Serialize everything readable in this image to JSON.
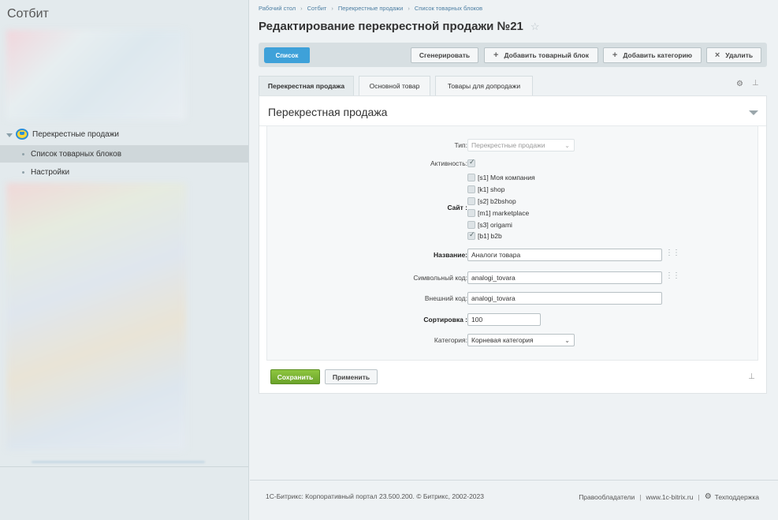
{
  "app": {
    "title": "Сотбит"
  },
  "sidebar": {
    "parent": {
      "label": "Перекрестные продажи",
      "icon": "basket-icon"
    },
    "items": [
      {
        "label": "Список товарных блоков",
        "active": true
      },
      {
        "label": "Настройки",
        "active": false
      }
    ]
  },
  "breadcrumb": [
    "Рабочий стол",
    "Сотбит",
    "Перекрестные продажи",
    "Список товарных блоков"
  ],
  "page": {
    "title": "Редактирование перекрестной продажи №21"
  },
  "toolbar": {
    "list_label": "Список",
    "generate_label": "Сгенерировать",
    "add_block_label": "Добавить товарный блок",
    "add_category_label": "Добавить категорию",
    "delete_label": "Удалить"
  },
  "tabs": [
    {
      "label": "Перекрестная продажа",
      "active": true
    },
    {
      "label": "Основной товар",
      "active": false
    },
    {
      "label": "Товары для допродажи",
      "active": false
    }
  ],
  "panel": {
    "title": "Перекрестная продажа"
  },
  "form": {
    "type": {
      "label": "Тип:",
      "value": "Перекрестные продажи"
    },
    "active": {
      "label": "Активность:",
      "checked": true
    },
    "site": {
      "label": "Сайт :",
      "options": [
        {
          "label": "[s1] Моя компания",
          "checked": false
        },
        {
          "label": "[k1] shop",
          "checked": false
        },
        {
          "label": "[s2] b2bshop",
          "checked": false
        },
        {
          "label": "[m1] marketplace",
          "checked": false
        },
        {
          "label": "[s3] origami",
          "checked": false
        },
        {
          "label": "[b1] b2b",
          "checked": true
        }
      ]
    },
    "name": {
      "label": "Название:",
      "value": "Аналоги товара"
    },
    "code": {
      "label": "Символьный код:",
      "value": "analogi_tovara"
    },
    "external_code": {
      "label": "Внешний код:",
      "value": "analogi_tovara"
    },
    "sort": {
      "label": "Сортировка :",
      "value": "100"
    },
    "category": {
      "label": "Категория:",
      "value": "Корневая категория"
    }
  },
  "actions": {
    "save_label": "Сохранить",
    "apply_label": "Применить"
  },
  "footer": {
    "copyright": "1С-Битрикс: Корпоративный портал 23.500.200. © Битрикс, 2002-2023",
    "rights_link": "Правообладатели",
    "site_link": "www.1c-bitrix.ru",
    "support_link": "Техподдержка"
  },
  "colors": {
    "accent": "#3ea1d9",
    "save": "#79b332",
    "sidebar_bg": "#e3eaed"
  }
}
